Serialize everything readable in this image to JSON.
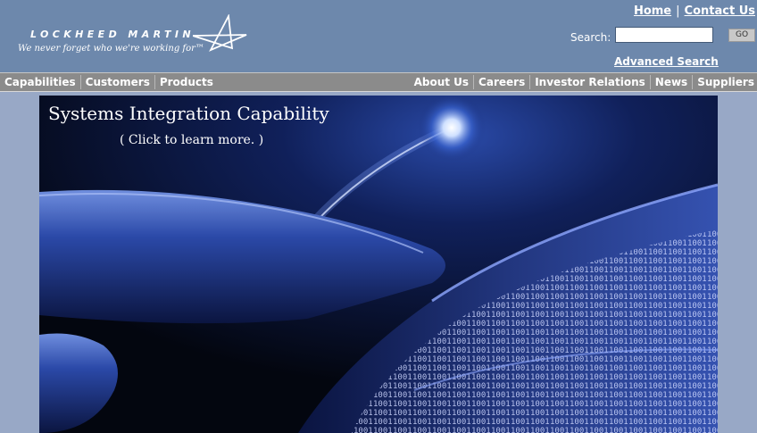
{
  "colors": {
    "header_bg": "#6d88ac",
    "nav_bg": "#8b8b8b",
    "page_bg": "#98a8c6",
    "link": "#ffffff"
  },
  "brand": {
    "wordmark": "LOCKHEED MARTIN",
    "tagline": "We never forget who we're working for™",
    "icon": "star-icon"
  },
  "top_links": {
    "home": "Home",
    "separator": "|",
    "contact": "Contact Us"
  },
  "search": {
    "label": "Search:",
    "value": "",
    "button": "GO",
    "advanced": "Advanced Search"
  },
  "nav": {
    "left": [
      "Capabilities",
      "Customers",
      "Products"
    ],
    "right": [
      "About Us",
      "Careers",
      "Investor Relations",
      "News",
      "Suppliers"
    ]
  },
  "banner": {
    "title": "Systems Integration Capability",
    "subtitle": "( Click to learn more. )",
    "image": "finger-touching-binary-ribbon"
  }
}
